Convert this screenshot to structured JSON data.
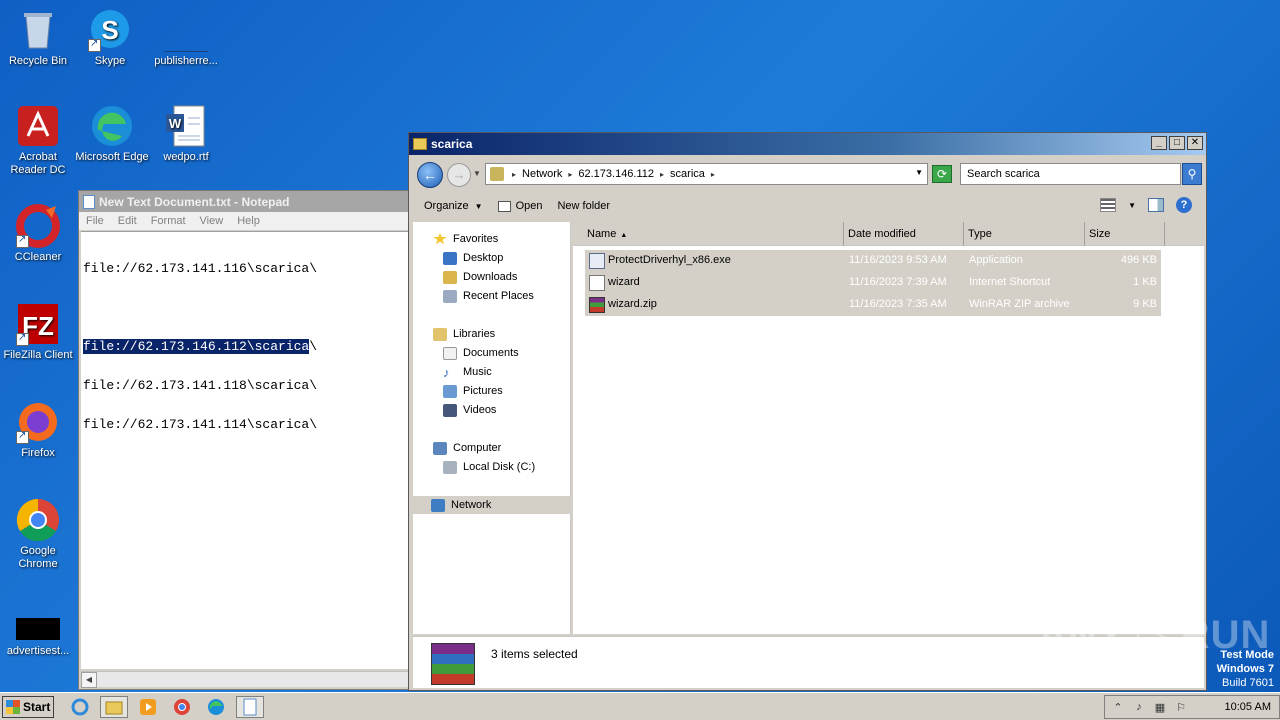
{
  "desktop": {
    "icons": [
      {
        "label": "Recycle Bin",
        "icon": "recycle-bin-icon"
      },
      {
        "label": "Skype",
        "icon": "skype-icon"
      },
      {
        "label": "publisherre...",
        "icon": "file-icon"
      },
      {
        "label": "Acrobat Reader DC",
        "icon": "acrobat-icon"
      },
      {
        "label": "Microsoft Edge",
        "icon": "edge-icon"
      },
      {
        "label": "wedpo.rtf",
        "icon": "word-document-icon"
      },
      {
        "label": "CCleaner",
        "icon": "ccleaner-icon"
      },
      {
        "label": "FileZilla Client",
        "icon": "filezilla-icon"
      },
      {
        "label": "Firefox",
        "icon": "firefox-icon"
      },
      {
        "label": "Google Chrome",
        "icon": "chrome-icon"
      },
      {
        "label": "advertisest...",
        "icon": "file-icon"
      }
    ]
  },
  "notepad": {
    "title": "New Text Document.txt - Notepad",
    "menu": [
      "File",
      "Edit",
      "Format",
      "View",
      "Help"
    ],
    "lines": [
      "file://62.173.141.116\\scarica\\",
      "",
      "file://62.173.146.112\\scarica\\",
      "file://62.173.141.118\\scarica\\",
      "file://62.173.141.114\\scarica\\"
    ],
    "selected_text": "file://62.173.146.112\\scarica",
    "selected_rest": "\\"
  },
  "explorer": {
    "title": "scarica",
    "window_buttons": {
      "minimize": "_",
      "maximize": "□",
      "close": "✕"
    },
    "breadcrumb": [
      "Network",
      "62.173.146.112",
      "scarica"
    ],
    "search_placeholder": "Search scarica",
    "toolbar": {
      "organize": "Organize",
      "open": "Open",
      "new_folder": "New folder"
    },
    "nav": {
      "favorites": "Favorites",
      "desktop": "Desktop",
      "downloads": "Downloads",
      "recent_places": "Recent Places",
      "libraries": "Libraries",
      "documents": "Documents",
      "music": "Music",
      "pictures": "Pictures",
      "videos": "Videos",
      "computer": "Computer",
      "local_disk": "Local Disk (C:)",
      "network": "Network"
    },
    "columns": {
      "name": "Name",
      "date": "Date modified",
      "type": "Type",
      "size": "Size"
    },
    "files": [
      {
        "name": "ProtectDriverhyl_x86.exe",
        "date": "11/16/2023 9:53 AM",
        "type": "Application",
        "size": "496 KB"
      },
      {
        "name": "wizard",
        "date": "11/16/2023 7:39 AM",
        "type": "Internet Shortcut",
        "size": "1 KB"
      },
      {
        "name": "wizard.zip",
        "date": "11/16/2023 7:35 AM",
        "type": "WinRAR ZIP archive",
        "size": "9 KB"
      }
    ],
    "status": "3 items selected"
  },
  "taskbar": {
    "start": "Start",
    "clock": "10:05 AM"
  },
  "watermark": "ANY ▷ RUN",
  "test_mode": {
    "line1": "Test Mode",
    "line2": "Windows 7",
    "line3": "Build 7601"
  },
  "colors": {
    "selection": "#0a246a",
    "desktop": "#1f7bd8"
  }
}
